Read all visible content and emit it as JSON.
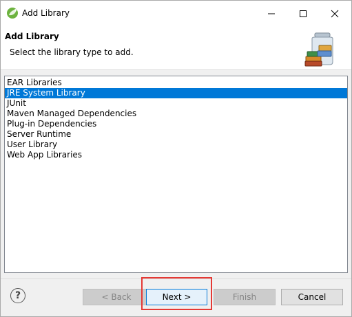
{
  "window": {
    "title": "Add Library",
    "controls": {
      "minimize": "minimize-icon",
      "maximize": "maximize-icon",
      "close": "close-icon"
    }
  },
  "banner": {
    "title": "Add Library",
    "description": "Select the library type to add.",
    "icon": "library-jar-icon"
  },
  "library_types": {
    "items": [
      "EAR Libraries",
      "JRE System Library",
      "JUnit",
      "Maven Managed Dependencies",
      "Plug-in Dependencies",
      "Server Runtime",
      "User Library",
      "Web App Libraries"
    ],
    "selected": "JRE System Library"
  },
  "footer": {
    "help": "?",
    "back_label": "< Back",
    "next_label": "Next >",
    "finish_label": "Finish",
    "cancel_label": "Cancel"
  },
  "colors": {
    "selection": "#0078d7",
    "highlight_box": "#e53935"
  }
}
